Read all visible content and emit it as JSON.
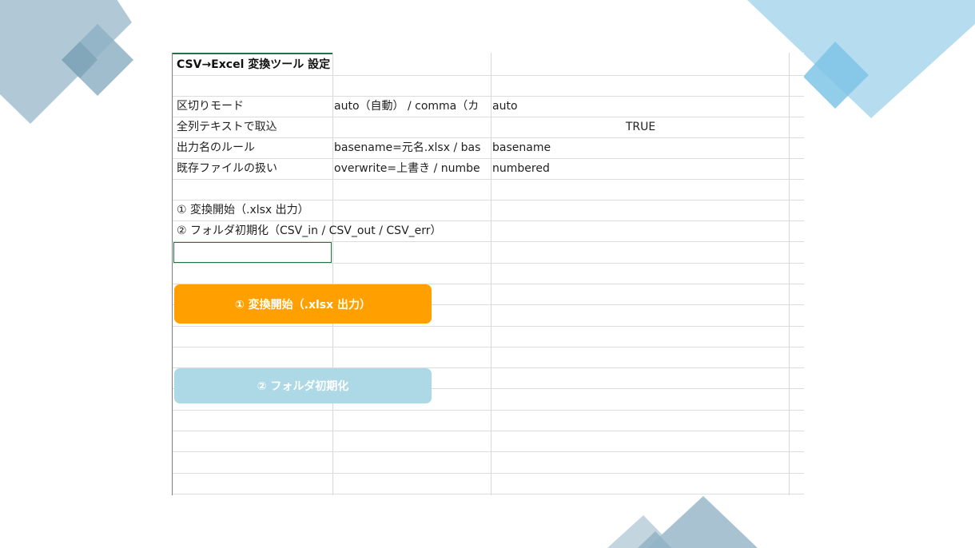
{
  "sheet": {
    "title": "CSV→Excel 変換ツール 設定",
    "rows": [
      {
        "label": "区切りモード",
        "desc": "auto（自動） / comma（カ",
        "value": "auto"
      },
      {
        "label": "全列テキストで取込",
        "desc": "",
        "value": "TRUE"
      },
      {
        "label": "出力名のルール",
        "desc": "basename=元名.xlsx / bas",
        "value": "basename"
      },
      {
        "label": "既存ファイルの扱い",
        "desc": "overwrite=上書き / numbe",
        "value": "numbered"
      }
    ],
    "notes": [
      "① 変換開始（.xlsx 出力）",
      "② フォルダ初期化（CSV_in / CSV_out / CSV_err）"
    ]
  },
  "buttons": {
    "convert_label": "① 変換開始（.xlsx 出力）",
    "init_label": "② フォルダ初期化"
  },
  "colors": {
    "convert_button": "#FFA000",
    "init_button": "#ADD8E6",
    "selection": "#217346"
  }
}
